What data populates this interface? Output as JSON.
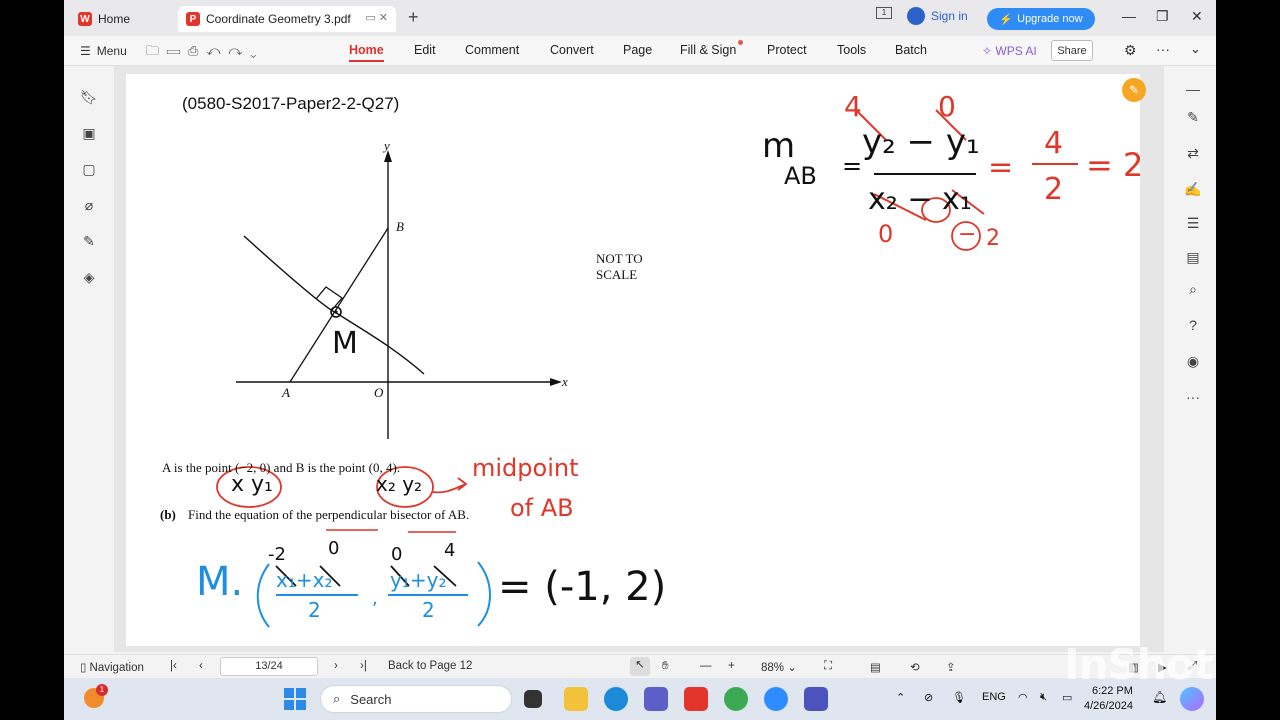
{
  "tabs": {
    "home": "Home",
    "doc": "Coordinate Geometry 3.pdf"
  },
  "header": {
    "sign_in": "Sign in",
    "upgrade": "Upgrade now"
  },
  "menubar": {
    "menu": "Menu",
    "nav": [
      "Home",
      "Edit",
      "Comment",
      "Convert",
      "Page",
      "Fill & Sign",
      "Protect",
      "Tools",
      "Batch"
    ],
    "wps_ai": "WPS AI",
    "share": "Share"
  },
  "document": {
    "question_title": "(0580-S2017-Paper2-2-Q27)",
    "axis_y": "y",
    "axis_x": "x",
    "label_A": "A",
    "label_B": "B",
    "label_O": "O",
    "not_to_scale_1": "NOT TO",
    "not_to_scale_2": "SCALE",
    "statement": "A is the point (−2, 0) and B is the point (0, 4).",
    "part_label": "(b)",
    "part_text": "Find the equation of the perpendicular bisector of AB."
  },
  "annotations": {
    "m_label": "M",
    "xy1": "x y₁",
    "xy2": "x₂ y₂",
    "midpoint": "midpoint",
    "of_ab": "of AB",
    "m_formula_lhs": "M.",
    "neg2": "-2",
    "zero_a": "0",
    "zero_b": "0",
    "four": "4",
    "x1x2": "x₁+x₂",
    "y1y2": "y₁+y₂",
    "two": "2",
    "result": "= (-1, 2)",
    "grad_m": "m",
    "grad_ab": "AB",
    "grad_num": "y₂ − y₁",
    "grad_den": "x₂ − x₁",
    "grad_top_4": "4",
    "grad_top_0": "0",
    "grad_bot_0": "0",
    "grad_bot_neg": "−",
    "grad_bot_2": "2",
    "frac_4": "4",
    "frac_2": "2",
    "eq2": "= 2"
  },
  "statusbar": {
    "navigation": "Navigation",
    "page": "13/24",
    "back": "Back to Page 12",
    "zoom": "88%"
  },
  "taskbar": {
    "search": "Search",
    "lang": "ENG",
    "time": "6:22 PM",
    "date": "4/26/2024"
  },
  "watermark": "InShot",
  "colors": {
    "accent_red": "#d33b2c",
    "ink_red": "#e0372a",
    "ink_blue": "#1e8fe0",
    "upgrade_blue": "#2f8cf7"
  }
}
